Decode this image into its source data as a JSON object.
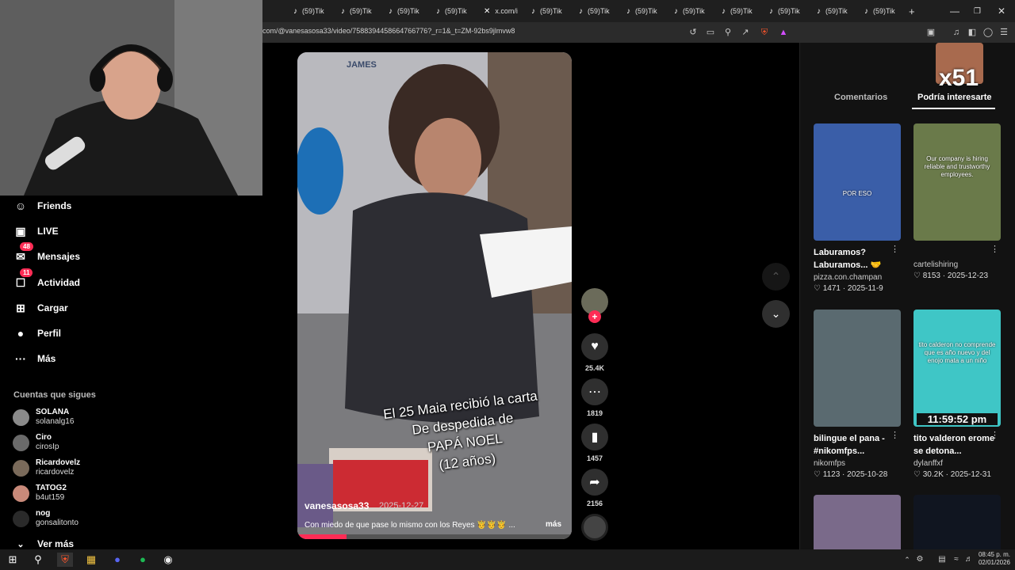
{
  "browser": {
    "tabs": [
      {
        "label": "(59)Tik",
        "icon": "tiktok-icon"
      },
      {
        "label": "(59)Tik",
        "icon": "tiktok-icon"
      },
      {
        "label": "(59)Tik",
        "icon": "tiktok-icon"
      },
      {
        "label": "(59)Tik",
        "icon": "tiktok-icon"
      },
      {
        "label": "x.com/i",
        "icon": "x-icon"
      },
      {
        "label": "(59)Tik",
        "icon": "tiktok-icon"
      },
      {
        "label": "(59)Tik",
        "icon": "tiktok-icon"
      },
      {
        "label": "(59)Tik",
        "icon": "tiktok-icon"
      },
      {
        "label": "(59)Tik",
        "icon": "tiktok-icon"
      },
      {
        "label": "(59)Tik",
        "icon": "tiktok-icon"
      },
      {
        "label": "(59)Tik",
        "icon": "tiktok-icon"
      },
      {
        "label": "(59)Tik",
        "icon": "tiktok-icon"
      },
      {
        "label": "(59)Tik",
        "icon": "tiktok-icon"
      }
    ],
    "new_tab": "+",
    "url": "com/@vanesasosa33/video/7588394458664766776?_r=1&_t=ZM-92bs9jlmvw8"
  },
  "webcam": {
    "overlay_text": "x51"
  },
  "nav": {
    "items": [
      {
        "label": "Friends",
        "icon": "friends-icon",
        "glyph": "☺"
      },
      {
        "label": "LIVE",
        "icon": "live-icon",
        "glyph": "▣"
      },
      {
        "label": "Mensajes",
        "icon": "messages-icon",
        "glyph": "✉",
        "badge": "48"
      },
      {
        "label": "Actividad",
        "icon": "activity-icon",
        "glyph": "☐",
        "badge": "11"
      },
      {
        "label": "Cargar",
        "icon": "upload-icon",
        "glyph": "⊞"
      },
      {
        "label": "Perfil",
        "icon": "profile-icon",
        "glyph": "●"
      },
      {
        "label": "Más",
        "icon": "more-icon",
        "glyph": "···"
      }
    ],
    "following_title": "Cuentas que sigues",
    "following": [
      {
        "name": "SOLANA",
        "handle": "solanalg16"
      },
      {
        "name": "Ciro",
        "handle": "cirosIp"
      },
      {
        "name": "Ricardovelz",
        "handle": "ricardovelz"
      },
      {
        "name": "TATOG2",
        "handle": "b4ut159"
      },
      {
        "name": "nog",
        "handle": "gonsalitonto"
      }
    ],
    "see_more": "Ver más"
  },
  "video": {
    "brand_watermark": "JAMES",
    "overlay_caption": "El 25 Maia recibió la carta\nDe despedida de\nPAPÁ NOEL\n(12 años)",
    "author": "vanesasosa33",
    "date": "2025-12-27",
    "caption": "Con miedo de que pase lo mismo con los Reyes 🤴🤴🤴 ...",
    "more": "más",
    "progress": 0.18
  },
  "actions": {
    "likes": "25.4K",
    "comments": "1819",
    "saves": "1457",
    "shares": "2156"
  },
  "right_panel": {
    "tab_comments": "Comentarios",
    "tab_suggested": "Podría interesarte",
    "cards": [
      {
        "title": "Laburamos? Laburamos... 🤝",
        "user": "pizza.con.champan",
        "likes": "1471",
        "date": "2025-11-9",
        "thumb_text": "POR ESO",
        "color": "#3a5ea8"
      },
      {
        "title": "",
        "user": "cartelishiring",
        "likes": "8153",
        "date": "2025-12-23",
        "thumb_text": "Our company is hiring reliable and trustworthy employees.",
        "color": "#6a7a4a"
      },
      {
        "title": "bilingue el pana - #nikomfps...",
        "user": "nikomfps",
        "likes": "1123",
        "date": "2025-10-28",
        "thumb_text": "",
        "color": "#5a6a70"
      },
      {
        "title": "tito valderon erome se detona...",
        "user": "dylanffxf",
        "likes": "30.2K",
        "date": "2025-12-31",
        "thumb_text": "tito calderon no comprende que es año nuevo y del enojo mata a un niño",
        "thumb_time": "11:59:52 pm",
        "color": "#3fc6c6"
      }
    ]
  },
  "taskbar": {
    "time": "08:45 p. m.",
    "date": "02/01/2026"
  }
}
